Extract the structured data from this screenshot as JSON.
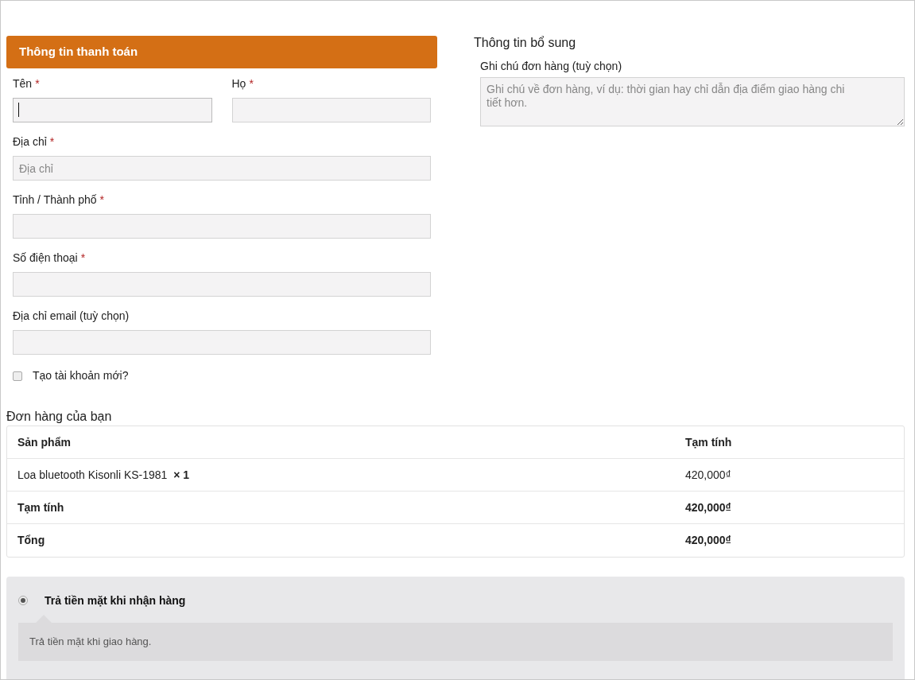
{
  "billing": {
    "title": "Thông tin thanh toán",
    "rows": [
      [
        {
          "label": "Tên",
          "required_mark": "*",
          "focused": true
        },
        {
          "label": "Họ",
          "required_mark": "*",
          "focused": false
        }
      ],
      [
        {
          "label": "Địa chỉ",
          "required_mark": "*",
          "focused": false,
          "placeholder": "Địa chỉ"
        }
      ],
      [
        {
          "label": "Tỉnh / Thành phố",
          "required_mark": "*",
          "focused": false
        }
      ],
      [
        {
          "label": "Số điện thoại",
          "required_mark": "*",
          "focused": false
        }
      ],
      [
        {
          "label": "Địa chỉ email (tuỳ chọn)",
          "focused": false
        }
      ]
    ],
    "create_account": {
      "label": "Tạo tài khoản mới?",
      "checked": false
    }
  },
  "additional": {
    "title": "Thông tin bổ sung",
    "notes": {
      "label": "Ghi chú đơn hàng (tuỳ chọn)",
      "placeholder": "Ghi chú về đơn hàng, ví dụ: thời gian hay chỉ dẫn địa điểm giao hàng chi tiết hơn."
    }
  },
  "order": {
    "title": "Đơn hàng của bạn",
    "columns": [
      "Sản phẩm",
      "Tạm tính"
    ],
    "rows": [
      {
        "kind": "item",
        "cells": [
          "Loa bluetooth Kisonli KS-1981  **× 1**",
          "420,000₫"
        ]
      },
      {
        "kind": "total",
        "cells": [
          "Tạm tính",
          "420,000₫"
        ]
      },
      {
        "kind": "total",
        "cells": [
          "Tổng",
          "420,000₫"
        ]
      }
    ]
  },
  "payment": {
    "methods": [
      {
        "label": "Trả tiền mặt khi nhận hàng",
        "selected": true,
        "description": "Trả tiền mặt khi giao hàng."
      }
    ]
  }
}
